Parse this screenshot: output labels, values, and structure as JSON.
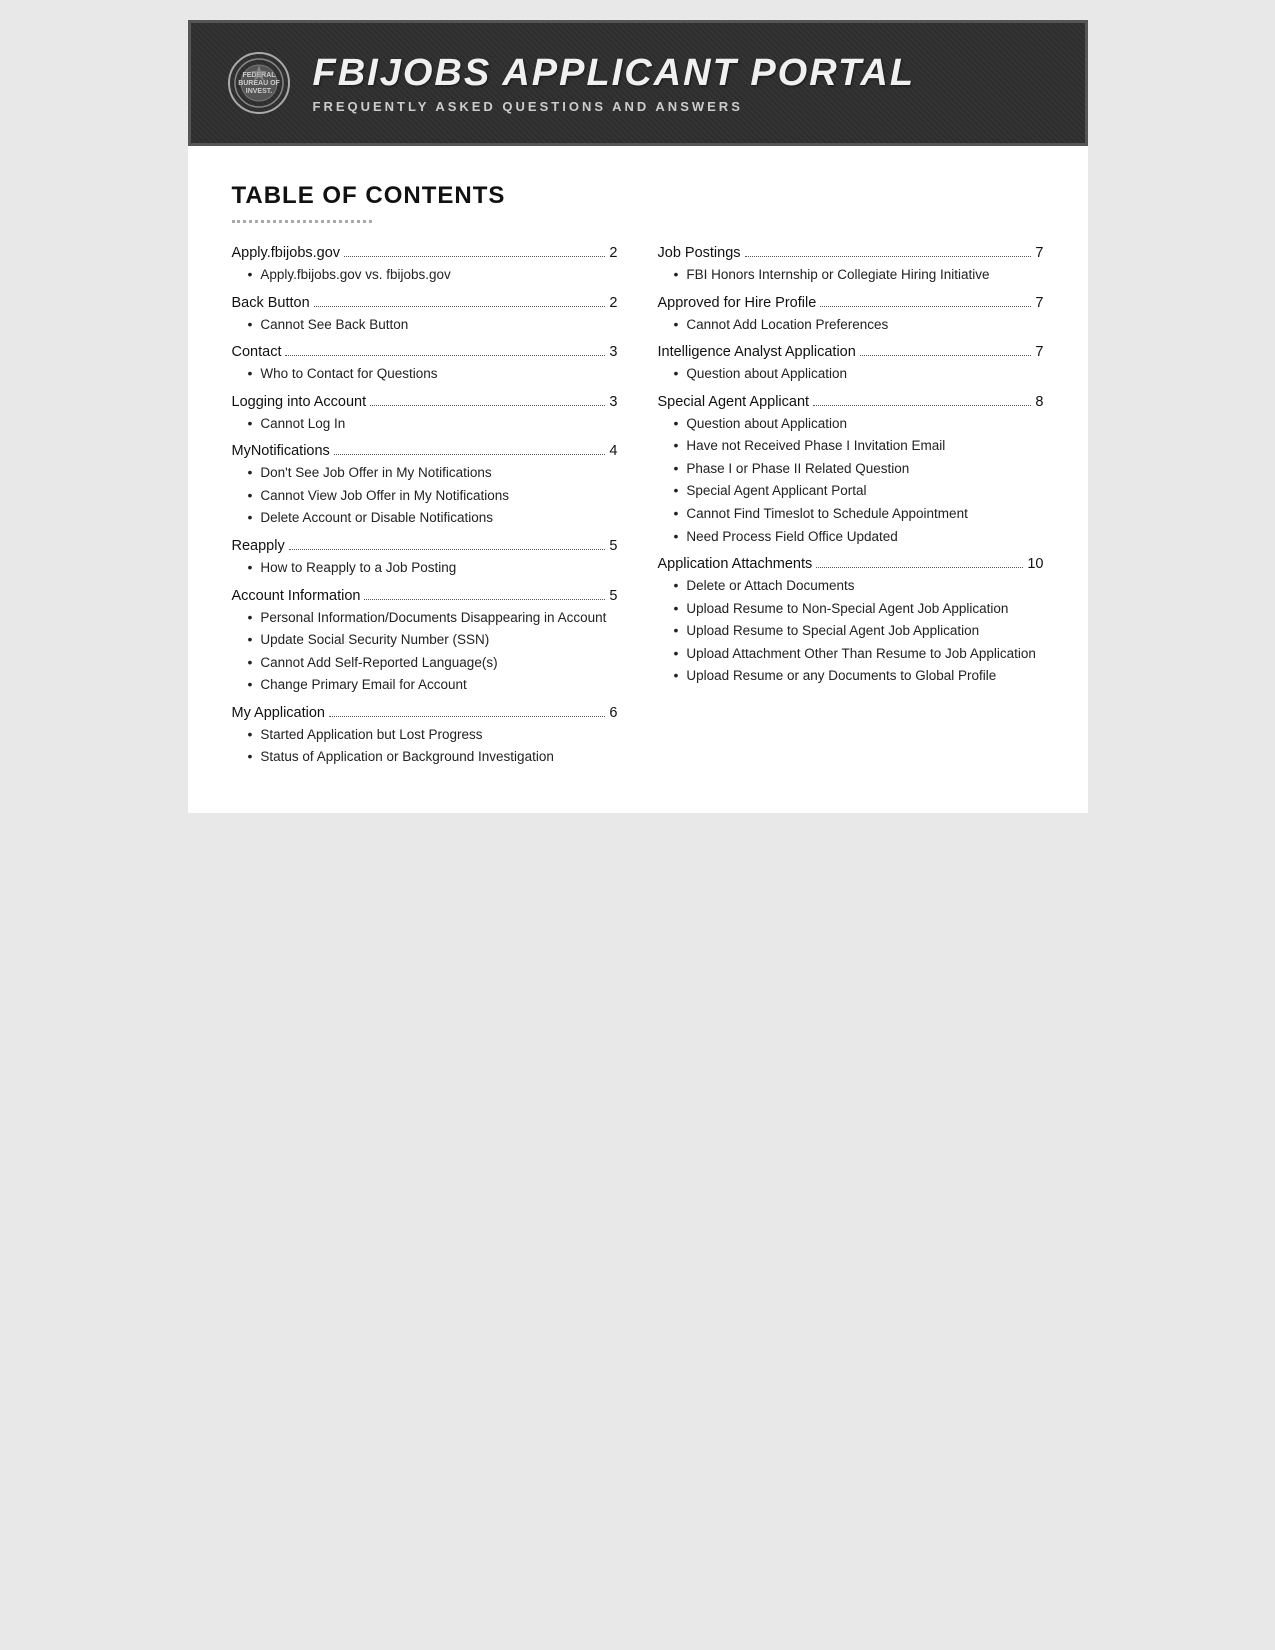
{
  "header": {
    "title": "FBIJOBS APPLICANT PORTAL",
    "subtitle": "FREQUENTLY ASKED QUESTIONS AND ANSWERS"
  },
  "toc_title": "TABLE OF CONTENTS",
  "left_column": [
    {
      "entry": "Apply.fbijobs.gov",
      "page": "2",
      "sub_items": [
        "Apply.fbijobs.gov vs. fbijobs.gov"
      ]
    },
    {
      "entry": "Back Button",
      "page": "2",
      "sub_items": [
        "Cannot See Back Button"
      ]
    },
    {
      "entry": "Contact",
      "page": "3",
      "sub_items": [
        "Who to Contact for Questions"
      ]
    },
    {
      "entry": "Logging into Account",
      "page": "3",
      "sub_items": [
        "Cannot Log In"
      ]
    },
    {
      "entry": "MyNotifications",
      "page": "4",
      "sub_items": [
        "Don't See Job Offer in My Notifications",
        "Cannot View Job Offer in My Notifications",
        "Delete Account or Disable Notifications"
      ]
    },
    {
      "entry": "Reapply",
      "page": "5",
      "sub_items": [
        "How to Reapply to a Job Posting"
      ]
    },
    {
      "entry": "Account Information",
      "page": "5",
      "sub_items": [
        "Personal Information/Documents Disappearing in Account",
        "Update Social Security Number (SSN)",
        "Cannot Add Self-Reported Language(s)",
        "Change Primary Email for Account"
      ]
    },
    {
      "entry": "My Application",
      "page": "6",
      "sub_items": [
        "Started Application but Lost Progress",
        "Status of Application or Background Investigation"
      ]
    }
  ],
  "right_column": [
    {
      "entry": "Job Postings",
      "page": "7",
      "sub_items": [
        "FBI Honors Internship or Collegiate Hiring Initiative"
      ]
    },
    {
      "entry": "Approved for Hire Profile",
      "page": "7",
      "sub_items": [
        "Cannot Add Location Preferences"
      ]
    },
    {
      "entry": "Intelligence Analyst Application",
      "page": "7",
      "sub_items": [
        "Question about Application"
      ]
    },
    {
      "entry": "Special Agent Applicant",
      "page": "8",
      "sub_items": [
        "Question about Application",
        "Have not Received Phase I Invitation Email",
        "Phase I or Phase II Related Question",
        "Special Agent Applicant Portal",
        "Cannot Find Timeslot to Schedule Appointment",
        "Need Process Field Office Updated"
      ]
    },
    {
      "entry": "Application Attachments",
      "page": "10",
      "sub_items": [
        "Delete or Attach Documents",
        "Upload Resume to Non-Special Agent Job Application",
        "Upload Resume to Special Agent Job Application",
        "Upload Attachment Other Than Resume to Job Application",
        "Upload Resume or any Documents to Global Profile"
      ]
    }
  ],
  "bullet_symbol": "•"
}
